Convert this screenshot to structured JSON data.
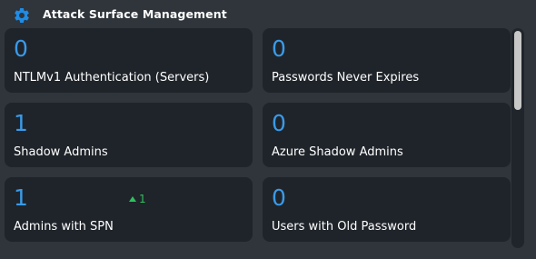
{
  "widget": {
    "title": "Attack Surface Management",
    "icon": "gear-icon",
    "accent_color": "#1f8ce6"
  },
  "cards": [
    {
      "value": "0",
      "label": "NTLMv1 Authentication (Servers)"
    },
    {
      "value": "0",
      "label": "Passwords Never Expires"
    },
    {
      "value": "1",
      "label": "Shadow Admins"
    },
    {
      "value": "0",
      "label": "Azure Shadow Admins"
    },
    {
      "value": "1",
      "label": "Admins with SPN",
      "delta": "1",
      "delta_direction": "up",
      "delta_color": "#2fbf5f"
    },
    {
      "value": "0",
      "label": "Users with Old Password"
    }
  ]
}
